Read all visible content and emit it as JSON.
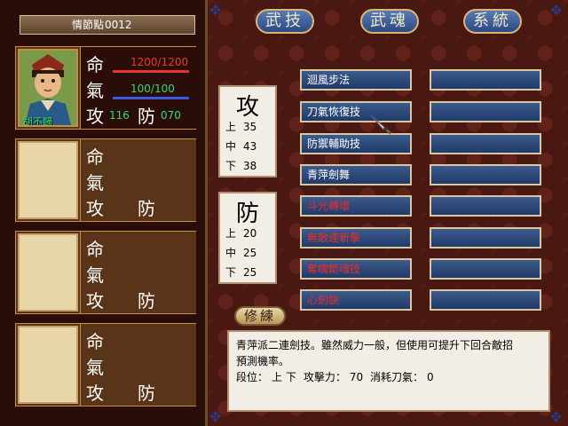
{
  "header": {
    "points_label": "情節點",
    "points_value": "0012"
  },
  "stat_glyphs": {
    "life": "命",
    "qi": "氣",
    "attack": "攻",
    "defense": "防"
  },
  "hero": {
    "name": "胡不歸",
    "hp": "1200/1200",
    "qi": "100/100",
    "attack": "116",
    "defense": "070",
    "hp_fraction": 1.0,
    "qi_fraction": 1.0
  },
  "tabs": {
    "martial": "武技",
    "soul": "武魂",
    "system": "系統"
  },
  "attack_box": {
    "title": "攻",
    "rows": [
      {
        "label": "上",
        "value": "35"
      },
      {
        "label": "中",
        "value": "43"
      },
      {
        "label": "下",
        "value": "38"
      }
    ]
  },
  "defense_box": {
    "title": "防",
    "rows": [
      {
        "label": "上",
        "value": "20"
      },
      {
        "label": "中",
        "value": "25"
      },
      {
        "label": "下",
        "value": "25"
      }
    ]
  },
  "skills_left": [
    {
      "label": "迴風步法",
      "style": "normal"
    },
    {
      "label": "刀氣恢復技",
      "style": "normal"
    },
    {
      "label": "防禦輔助技",
      "style": "normal"
    },
    {
      "label": "青萍劍舞",
      "style": "normal"
    },
    {
      "label": "斗光轉環",
      "style": "red"
    },
    {
      "label": "無敵連斬擊",
      "style": "red"
    },
    {
      "label": "奪魄斷魂技",
      "style": "red"
    },
    {
      "label": "心劍訣",
      "style": "red"
    }
  ],
  "practice_label": "修練",
  "description": {
    "line1": "青萍派二連劍技。雖然威力一般，但使用可提升下回合敵招",
    "line2": "預測機率。",
    "position_label": "段位：",
    "position_up": "上",
    "position_down": "下",
    "power_label": "攻擊力：",
    "power_value": "70",
    "cost_label": "消耗刀氣：",
    "cost_value": "0"
  },
  "colors": {
    "hp_bar": "#e8342c",
    "qi_bar": "#3a5ae0",
    "hero_stat": "#2ae06a"
  }
}
